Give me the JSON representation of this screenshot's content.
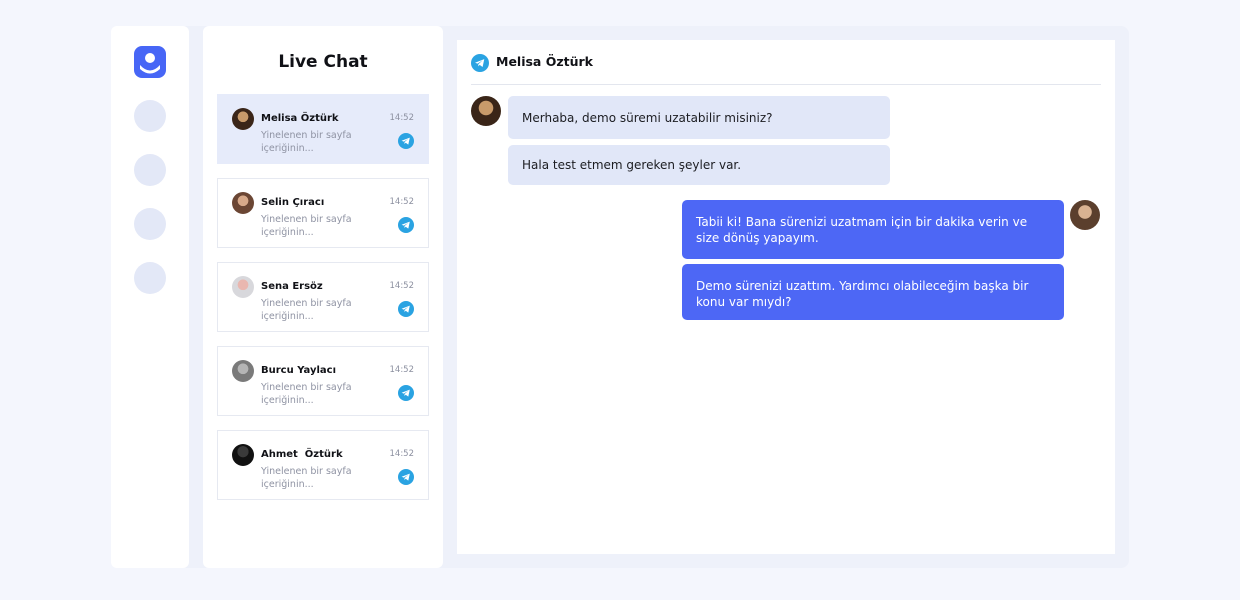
{
  "app": {
    "brand_color": "#4766f6",
    "telegram_color": "#2aa3e2"
  },
  "rail": {
    "items": [
      {
        "icon": "logo-icon"
      },
      {
        "icon": "nav-placeholder-icon"
      },
      {
        "icon": "nav-placeholder-icon"
      },
      {
        "icon": "nav-placeholder-icon"
      },
      {
        "icon": "nav-placeholder-icon"
      }
    ]
  },
  "chat_list": {
    "title": "Live Chat",
    "conversations": [
      {
        "name": "Melisa Öztürk",
        "time": "14:52",
        "preview": "Yinelenen bir sayfa içeriğinin...",
        "channel_icon": "telegram-icon",
        "active": true
      },
      {
        "name": "Selin Çıracı",
        "time": "14:52",
        "preview": "Yinelenen bir sayfa içeriğinin...",
        "channel_icon": "telegram-icon",
        "active": false
      },
      {
        "name": "Sena Ersöz",
        "time": "14:52",
        "preview": "Yinelenen bir sayfa içeriğinin...",
        "channel_icon": "telegram-icon",
        "active": false
      },
      {
        "name": "Burcu Yaylacı",
        "time": "14:52",
        "preview": "Yinelenen bir sayfa içeriğinin...",
        "channel_icon": "telegram-icon",
        "active": false
      },
      {
        "name": "Ahmet  Öztürk",
        "time": "14:52",
        "preview": "Yinelenen bir sayfa içeriğinin...",
        "channel_icon": "telegram-icon",
        "active": false
      }
    ]
  },
  "chat": {
    "header_title": "Melisa Öztürk",
    "header_icon": "telegram-icon",
    "messages": [
      {
        "direction": "incoming",
        "text": "Merhaba, demo süremi uzatabilir misiniz?"
      },
      {
        "direction": "incoming",
        "text": "Hala test etmem gereken şeyler var."
      },
      {
        "direction": "outgoing",
        "text": "Tabii ki! Bana sürenizi uzatmam için bir dakika verin ve size dönüş yapayım."
      },
      {
        "direction": "outgoing",
        "text": "Demo sürenizi uzattım. Yardımcı olabileceğim başka bir konu var mıydı?"
      }
    ]
  }
}
